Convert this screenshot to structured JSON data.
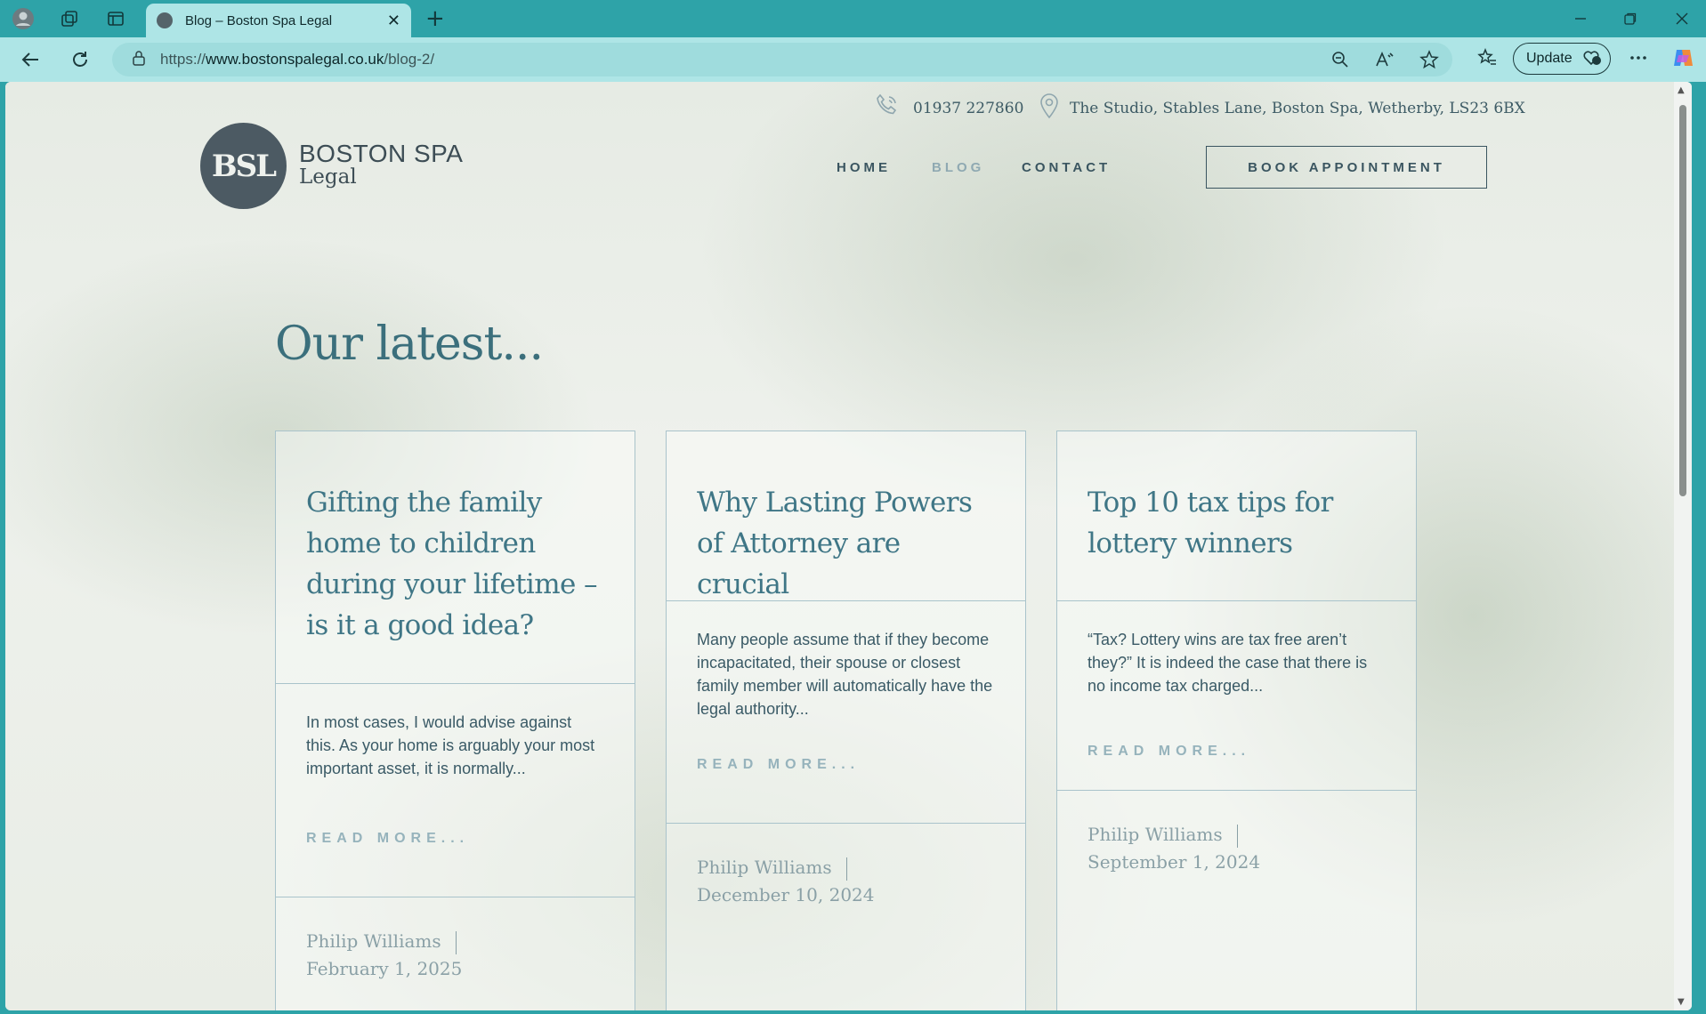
{
  "browser": {
    "tab_title": "Blog – Boston Spa Legal",
    "tab_close": "✕",
    "new_tab": "+",
    "url_prefix": "https://",
    "url_domain": "www.bostonspalegal.co.uk",
    "url_path": "/blog-2/",
    "update_label": "Update",
    "window_controls": [
      "minimize-icon",
      "restore-icon",
      "close-icon"
    ]
  },
  "site": {
    "phone": "01937 227860",
    "address": "The Studio, Stables Lane, Boston Spa, Wetherby, LS23 6BX",
    "logo_mark": "BSL",
    "brand_line1": "BOSTON SPA",
    "brand_line2": "Legal",
    "nav": [
      {
        "label": "HOME",
        "active": false
      },
      {
        "label": "BLOG",
        "active": true
      },
      {
        "label": "CONTACT",
        "active": false
      }
    ],
    "book_button": "BOOK APPOINTMENT",
    "heading": "Our latest..."
  },
  "posts": [
    {
      "title": "Gifting the family home to children during your lifetime – is it a good idea?",
      "excerpt": "In most cases, I would advise against this. As your home is arguably your most important asset, it is normally...",
      "more": "READ MORE...",
      "author": "Philip Williams",
      "date": "February 1, 2025"
    },
    {
      "title": "Why Lasting Powers of Attorney are crucial",
      "excerpt": "Many people assume that if they become incapacitated, their spouse or closest family member will automatically have the legal authority...",
      "more": "READ MORE...",
      "author": "Philip Williams",
      "date": "December 10, 2024"
    },
    {
      "title": "Top 10 tax tips for lottery winners",
      "excerpt": "“Tax? Lottery wins are tax free aren’t they?” It is indeed the case that there is no income tax charged...",
      "more": "READ MORE...",
      "author": "Philip Williams",
      "date": "September 1, 2024"
    }
  ],
  "colors": {
    "chrome_teal": "#2ea3a8",
    "toolbar": "#aee5e6",
    "nav_text": "#3a5560",
    "nav_active": "#8fa9b2",
    "heading": "#3b6f7c"
  }
}
